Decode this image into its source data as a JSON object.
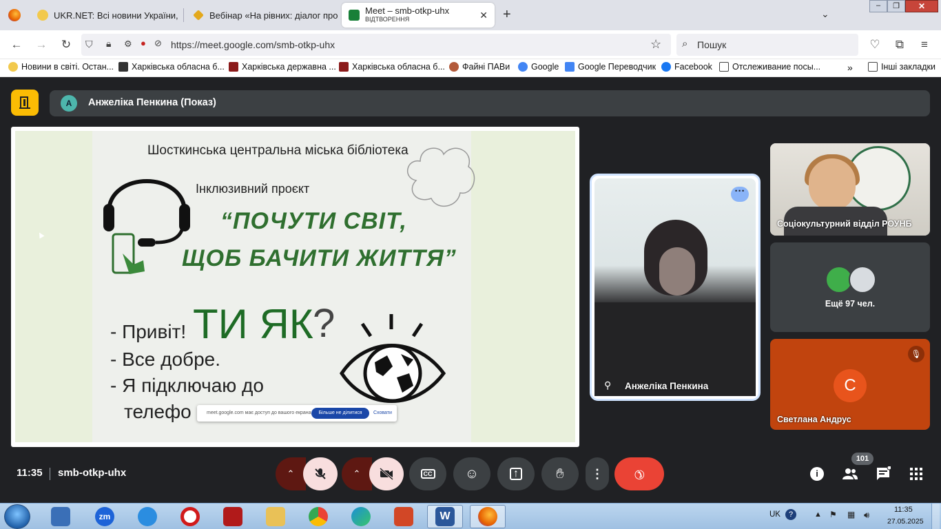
{
  "browser": {
    "tabs": [
      {
        "label": "UKR.NET: Всі новини України, ",
        "favicon_color": "#f2c94c"
      },
      {
        "label": "Вебінар «На рівних: діалог про",
        "favicon_color": "#e3a81c"
      },
      {
        "label": "Meet – smb-otkp-uhx",
        "sublabel": "ВІДТВОРЕННЯ",
        "favicon_color": "#188038"
      }
    ],
    "url": "https://meet.google.com/smb-otkp-uhx",
    "search_placeholder": "Пошук",
    "bookmarks": [
      {
        "label": "Новини в світі. Остан...",
        "icon": "ukrnet-icon",
        "color": "#f2c94c"
      },
      {
        "label": "Харківська обласна б...",
        "icon": "library-icon",
        "color": "#333"
      },
      {
        "label": "Харківська державна ...",
        "icon": "k-icon",
        "color": "#8b1a1a"
      },
      {
        "label": "Харківська обласна б...",
        "icon": "library-icon",
        "color": "#8b1a1a"
      },
      {
        "label": "Файні ПАВи",
        "icon": "avatar-icon",
        "color": "#b35a3a"
      },
      {
        "label": "Google",
        "icon": "google-icon",
        "color": "#4285f4"
      },
      {
        "label": "Google Переводчик",
        "icon": "translate-icon",
        "color": "#4285f4"
      },
      {
        "label": "Facebook",
        "icon": "facebook-icon",
        "color": "#1877f2"
      },
      {
        "label": "Отслеживание посы...",
        "icon": "mail-icon",
        "color": "#444"
      }
    ],
    "other_bookmarks": "Інші закладки"
  },
  "meet": {
    "presenter_initial": "A",
    "presenter_label": "Анжеліка Пенкина (Показ)",
    "slide": {
      "library": "Шосткинська центральна міська бібліотека",
      "project": "Інклюзивний проєкт",
      "quote_line1": "“ПОЧУТИ СВІТ,",
      "quote_line2": "ЩОБ БАЧИТИ ЖИТТЯ”",
      "line1": "- Привіт!",
      "big": "ТИ ЯК",
      "qmark": "?",
      "line2": "- Все добре.",
      "line3": "- Я підключаю до",
      "line4": "телефо"
    },
    "share_toast": {
      "message": "meet.google.com має доступ до вашого екрана",
      "stop_label": "Більше не ділитися",
      "hide_label": "Сховати"
    },
    "tiles": {
      "main_name": "Анжеліка Пенкина",
      "top_name": "Соціокультурний відділ РОУНБ",
      "more_label": "Ещё 97 чел.",
      "bottom_initial": "С",
      "bottom_name": "Светлана Андрус"
    },
    "time": "11:35",
    "meeting_code": "smb-otkp-uhx",
    "participants_count": "101"
  },
  "taskbar": {
    "apps": [
      {
        "name": "media-player-icon",
        "color": "#3a6fb7"
      },
      {
        "name": "zoom-icon",
        "color": "#1d63d8",
        "label": "zm"
      },
      {
        "name": "internet-explorer-icon",
        "color": "#2b8de0"
      },
      {
        "name": "opera-icon",
        "color": "#d11a1a"
      },
      {
        "name": "acrobat-icon",
        "color": "#b11a1a"
      },
      {
        "name": "file-explorer-icon",
        "color": "#e9c157"
      },
      {
        "name": "chrome-icon",
        "color": "#34a853"
      },
      {
        "name": "edge-icon",
        "color": "#1b8fd6"
      },
      {
        "name": "powerpoint-icon",
        "color": "#d24726"
      },
      {
        "name": "word-icon",
        "color": "#2b579a",
        "label": "W"
      },
      {
        "name": "firefox-icon",
        "color": "#e66000"
      }
    ],
    "lang": "UK",
    "clock_time": "11:35",
    "clock_date": "27.05.2025"
  }
}
